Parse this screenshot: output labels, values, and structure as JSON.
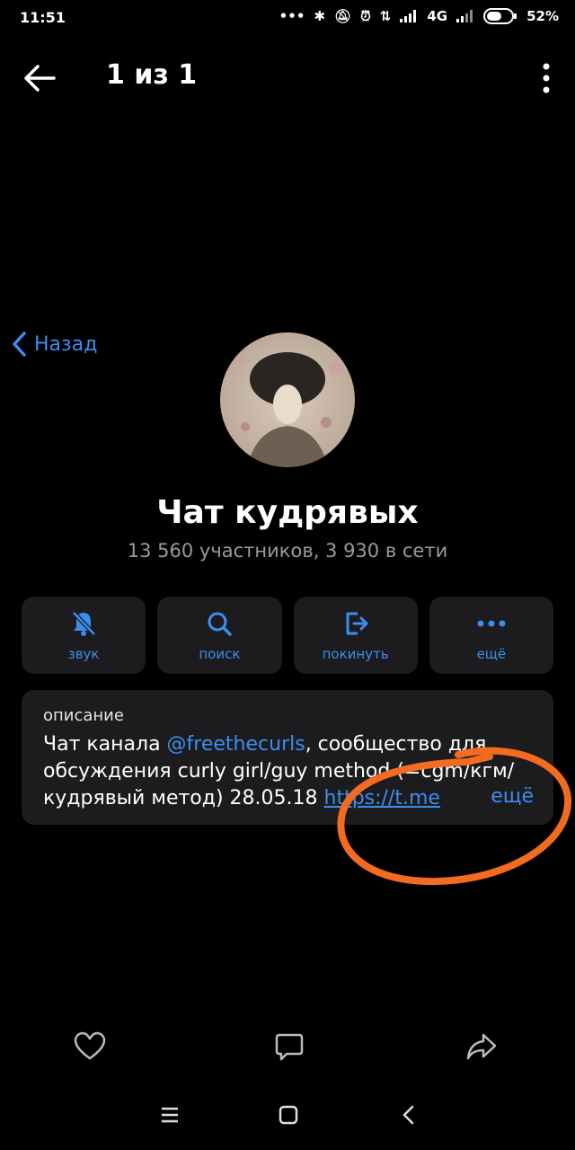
{
  "status_bar": {
    "time": "11:51",
    "network": "4G",
    "battery": "52%"
  },
  "viewer": {
    "title": "1 из 1"
  },
  "back_link": {
    "label": "Назад"
  },
  "chat": {
    "title": "Чат кудрявых",
    "subtitle": "13 560 участников, 3 930 в сети"
  },
  "actions": [
    {
      "label": "звук",
      "icon": "bell-mute-icon"
    },
    {
      "label": "поиск",
      "icon": "search-icon"
    },
    {
      "label": "покинуть",
      "icon": "leave-icon"
    },
    {
      "label": "ещё",
      "icon": "more-horizontal-icon"
    }
  ],
  "description": {
    "header": "описание",
    "prefix": "Чат канала ",
    "mention": "@freethecurls",
    "text_after_mention": ", сообщество для обсуждения curly girl/guy method (=cgm/кгм/кудрявый метод) 28.05.18 ",
    "link": "https://t.me",
    "more": "ещё"
  },
  "colors": {
    "accent": "#3c8df0",
    "card": "#1c1c1e",
    "annotation": "#f26b21"
  }
}
